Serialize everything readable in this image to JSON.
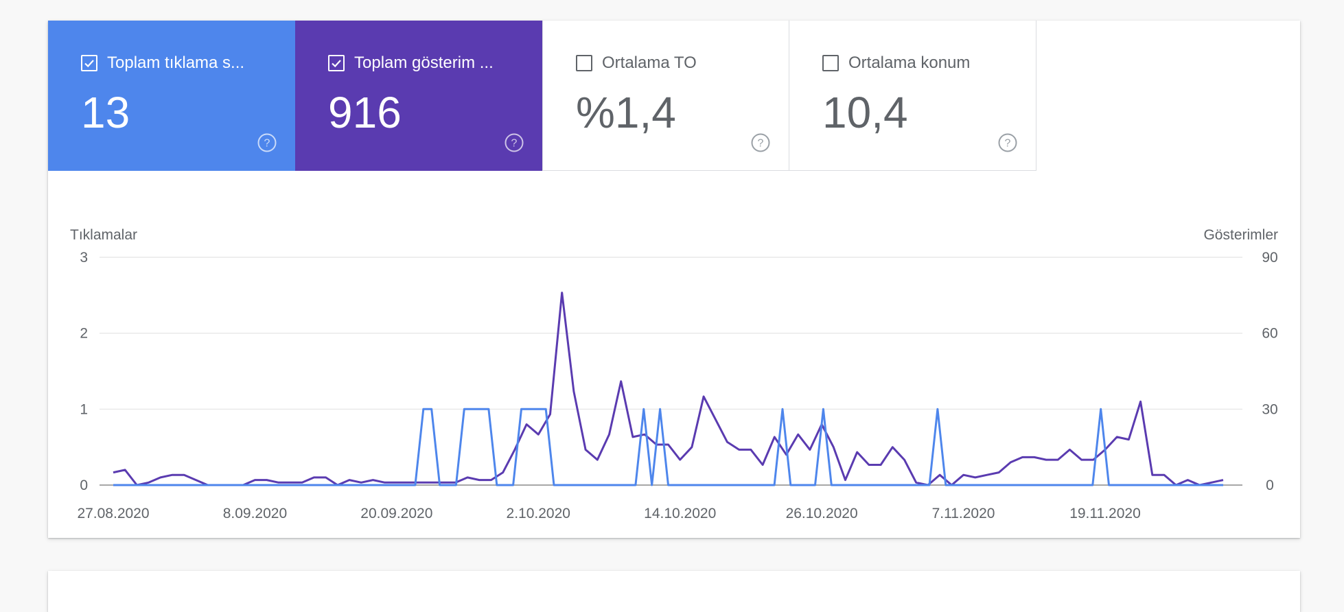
{
  "tiles": [
    {
      "label": "Toplam tıklama s...",
      "value": "13",
      "checked": true,
      "color": "#4e86ec"
    },
    {
      "label": "Toplam gösterim ...",
      "value": "916",
      "checked": true,
      "color": "#5a3bb0"
    },
    {
      "label": "Ortalama TO",
      "value": "%1,4",
      "checked": false,
      "color": "#ffffff"
    },
    {
      "label": "Ortalama konum",
      "value": "10,4",
      "checked": false,
      "color": "#ffffff"
    }
  ],
  "icons": {
    "checkbox": "checkbox-icon",
    "help": "help-circle-icon"
  },
  "chart_data": {
    "type": "line",
    "ylabel_left": "Tıklamalar",
    "ylabel_right": "Gösterimler",
    "y_left_ticks": [
      "0",
      "1",
      "2",
      "3"
    ],
    "y_right_ticks": [
      "0",
      "30",
      "60",
      "90"
    ],
    "ylim_left": [
      0,
      3
    ],
    "ylim_right": [
      0,
      90
    ],
    "x_ticks": [
      "27.08.2020",
      "8.09.2020",
      "20.09.2020",
      "2.10.2020",
      "14.10.2020",
      "26.10.2020",
      "7.11.2020",
      "19.11.2020"
    ],
    "x_start": "2020-08-27",
    "x_end": "2020-11-29",
    "grid": true,
    "series": [
      {
        "axis": "right",
        "color": "#5a3bb0",
        "values": [
          5,
          6,
          0,
          1,
          3,
          4,
          4,
          2,
          0,
          0,
          0,
          0,
          2,
          2,
          1,
          1,
          1,
          3,
          3,
          0,
          2,
          1,
          2,
          1,
          1,
          1,
          1,
          1,
          1,
          1,
          3,
          2,
          2,
          5,
          14,
          24,
          20,
          28,
          76,
          37,
          14,
          10,
          20,
          41,
          19,
          20,
          16,
          16,
          10,
          15,
          35,
          26,
          17,
          14,
          14,
          8,
          19,
          12,
          20,
          14,
          24,
          15,
          2,
          13,
          8,
          8,
          15,
          10,
          1,
          0,
          4,
          0,
          4,
          3,
          4,
          5,
          9,
          11,
          11,
          10,
          10,
          14,
          10,
          10,
          14,
          19,
          18,
          33,
          4,
          4,
          0,
          2,
          0,
          1,
          2
        ]
      },
      {
        "axis": "left",
        "color": "#4e86ec",
        "values": [
          0,
          0,
          0,
          0,
          0,
          0,
          0,
          0,
          0,
          0,
          0,
          0,
          0,
          0,
          0,
          0,
          0,
          0,
          0,
          0,
          0,
          0,
          0,
          0,
          0,
          0,
          0,
          0,
          0,
          0,
          0,
          0,
          0,
          0,
          0,
          0,
          0,
          0,
          1,
          1,
          0,
          0,
          0,
          1,
          1,
          1,
          1,
          0,
          0,
          0,
          1,
          1,
          1,
          1,
          0,
          0,
          0,
          0,
          0,
          0,
          0,
          0,
          0,
          0,
          0,
          1,
          0,
          1,
          0,
          0,
          0,
          0,
          0,
          0,
          0,
          0,
          0,
          0,
          0,
          0,
          0,
          0,
          1,
          0,
          0,
          0,
          0,
          1,
          0,
          0,
          0,
          0,
          0,
          0,
          0,
          0,
          0,
          0,
          0,
          0,
          0,
          1,
          0,
          0,
          0,
          0,
          0,
          0,
          0,
          0,
          0,
          0,
          0,
          0,
          0,
          0,
          0,
          0,
          0,
          0,
          0,
          1,
          0,
          0,
          0,
          0,
          0,
          0,
          0,
          0,
          0,
          0,
          0,
          0,
          0,
          0,
          0
        ]
      }
    ]
  }
}
